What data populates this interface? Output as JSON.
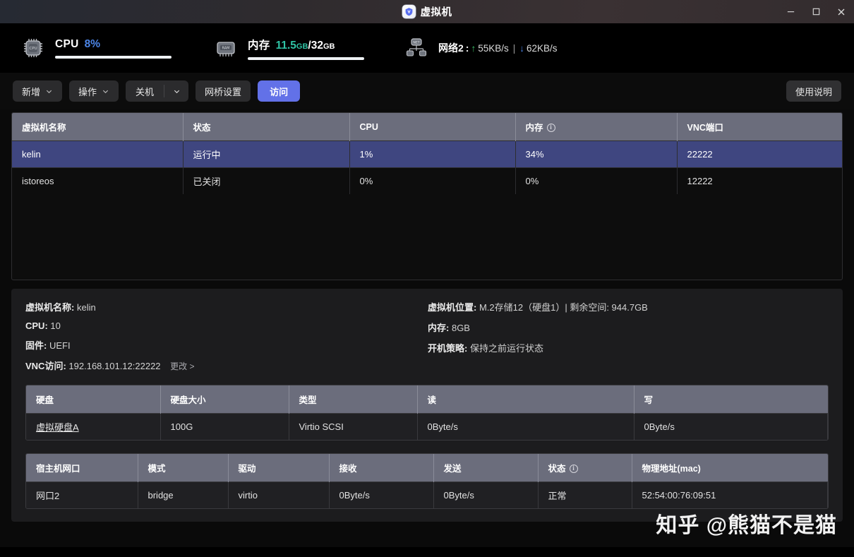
{
  "titlebar": {
    "title": "虚拟机",
    "app_icon": "shield-v-icon",
    "minimize": "–",
    "maximize": "□",
    "close": "✕"
  },
  "stats": {
    "cpu": {
      "icon": "cpu-chip-icon",
      "label": "CPU",
      "value": "8%",
      "percent": 8,
      "color": "#4d86e8"
    },
    "memory": {
      "icon": "ram-chip-icon",
      "label": "内存",
      "used": "11.5",
      "used_unit": "GB",
      "separator": "/",
      "total": "32",
      "total_unit": "GB",
      "percent": 36,
      "color": "#2fc3a5"
    },
    "network": {
      "icon": "network-icon",
      "label": "网络2",
      "colon": ":",
      "up_arrow": "↑",
      "up_value": "55KB/s",
      "divider": "|",
      "down_arrow": "↓",
      "down_value": "62KB/s"
    }
  },
  "toolbar": {
    "buttons": [
      {
        "label": "新增",
        "type": "dropdown"
      },
      {
        "label": "操作",
        "type": "dropdown"
      },
      {
        "label": "关机",
        "type": "split"
      },
      {
        "label": "网桥设置",
        "type": "plain"
      },
      {
        "label": "访问",
        "type": "primary"
      }
    ],
    "help_label": "使用说明"
  },
  "vm_table": {
    "columns": [
      {
        "label": "虚拟机名称",
        "info": false
      },
      {
        "label": "状态",
        "info": false
      },
      {
        "label": "CPU",
        "info": false
      },
      {
        "label": "内存",
        "info": true
      },
      {
        "label": "VNC端口",
        "info": false
      }
    ],
    "rows": [
      {
        "name": "kelin",
        "state": "运行中",
        "cpu": "1%",
        "mem": "34%",
        "vnc": "22222",
        "selected": true
      },
      {
        "name": "istoreos",
        "state": "已关闭",
        "cpu": "0%",
        "mem": "0%",
        "vnc": "12222",
        "selected": false
      }
    ]
  },
  "detail": {
    "left": [
      {
        "label": "虚拟机名称:",
        "value": "kelin"
      },
      {
        "label": "CPU:",
        "value": "10"
      },
      {
        "label": "固件:",
        "value": "UEFI"
      },
      {
        "label": "VNC访问:",
        "value": "192.168.101.12:22222",
        "link": "更改 >"
      }
    ],
    "right": [
      {
        "label": "虚拟机位置:",
        "value": "M.2存储12（硬盘1）| 剩余空间: 944.7GB"
      },
      {
        "label": "内存:",
        "value": "8GB"
      },
      {
        "label": "开机策略:",
        "value": "保持之前运行状态"
      }
    ],
    "disk_table": {
      "columns": [
        {
          "label": "硬盘",
          "info": false
        },
        {
          "label": "硬盘大小",
          "info": false
        },
        {
          "label": "类型",
          "info": false
        },
        {
          "label": "读",
          "info": false
        },
        {
          "label": "写",
          "info": false
        }
      ],
      "rows": [
        {
          "disk": "虚拟硬盘A",
          "size": "100G",
          "type": "Virtio SCSI",
          "read": "0Byte/s",
          "write": "0Byte/s"
        }
      ]
    },
    "net_table": {
      "columns": [
        {
          "label": "宿主机网口",
          "info": false
        },
        {
          "label": "模式",
          "info": false
        },
        {
          "label": "驱动",
          "info": false
        },
        {
          "label": "接收",
          "info": false
        },
        {
          "label": "发送",
          "info": false
        },
        {
          "label": "状态",
          "info": true
        },
        {
          "label": "物理地址(mac)",
          "info": false
        }
      ],
      "rows": [
        {
          "port": "网口2",
          "mode": "bridge",
          "driver": "virtio",
          "rx": "0Byte/s",
          "tx": "0Byte/s",
          "state": "正常",
          "mac": "52:54:00:76:09:51"
        }
      ]
    }
  },
  "watermark": "知乎 @熊猫不是猫",
  "colors": {
    "accent": "#6271e8",
    "selected_row": "#3f4680",
    "cpu_bar": "#4d86e8",
    "mem_bar": "#2fc3a5",
    "header_bg": "#6b6d7c"
  }
}
